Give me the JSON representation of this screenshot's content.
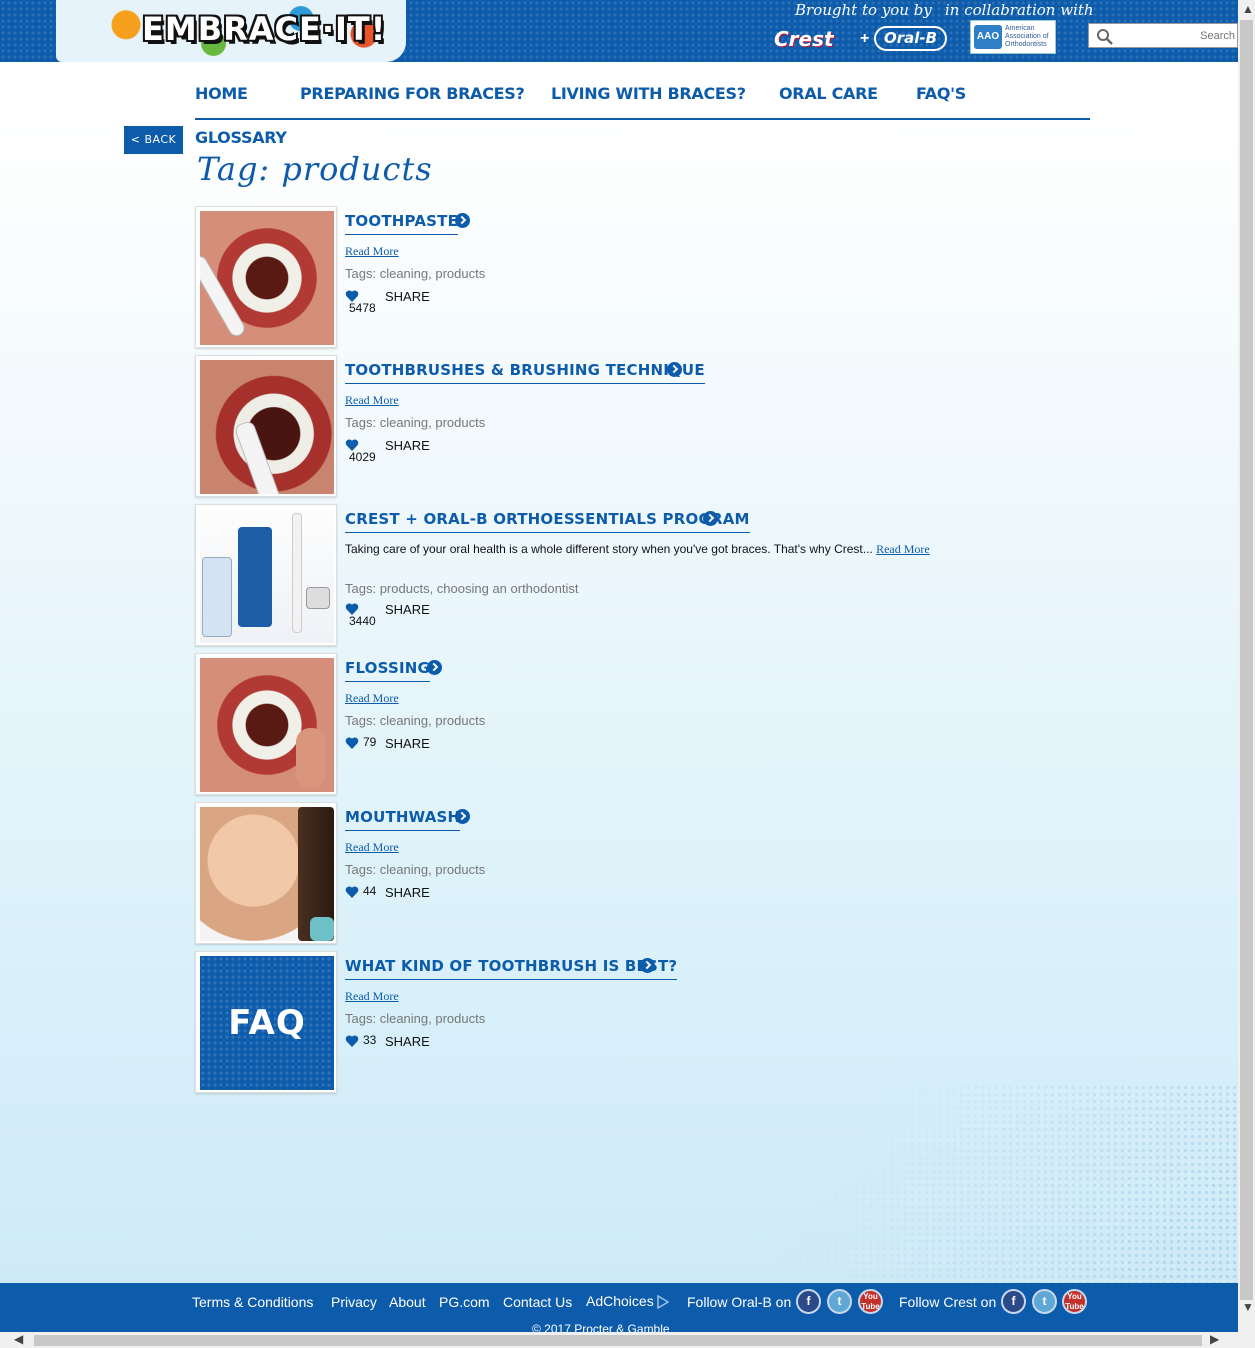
{
  "header": {
    "logo_text": "EMBRACE·IT!",
    "brought_by": "Brought to you by",
    "collab": "in collabration with",
    "crest": "Crest",
    "plus": "+",
    "oralb": "Oral-B",
    "aao_badge": "AAO",
    "aao_text": "American Association of Orthodontists",
    "search_placeholder": "Search"
  },
  "nav": {
    "items": [
      "HOME",
      "PREPARING FOR BRACES?",
      "LIVING WITH BRACES?",
      "ORAL CARE",
      "FAQ'S"
    ],
    "glossary": "GLOSSARY",
    "back": "< BACK"
  },
  "page_title": "Tag: products",
  "items": [
    {
      "title": "TOOTHPASTE",
      "read_more": "Read More",
      "tags_label": "Tags:",
      "tags": "cleaning, products",
      "likes": "5478",
      "share": "SHARE"
    },
    {
      "title": "TOOTHBRUSHES & BRUSHING TECHNIQUE",
      "read_more": "Read More",
      "tags_label": "Tags:",
      "tags": "cleaning, products",
      "likes": "4029",
      "share": "SHARE"
    },
    {
      "title": "CREST + ORAL-B ORTHOESSENTIALS PROGRAM",
      "excerpt": "Taking care of your oral health is a whole different story when you've got braces. That's why Crest...",
      "read_more": "Read More",
      "tags_label": "Tags:",
      "tags": "products, choosing an orthodontist",
      "likes": "3440",
      "share": "SHARE"
    },
    {
      "title": "FLOSSING",
      "read_more": "Read More",
      "tags_label": "Tags:",
      "tags": "cleaning, products",
      "likes": "79",
      "share": "SHARE"
    },
    {
      "title": "MOUTHWASH",
      "read_more": "Read More",
      "tags_label": "Tags:",
      "tags": "cleaning, products",
      "likes": "44",
      "share": "SHARE"
    },
    {
      "title": "WHAT KIND OF TOOTHBRUSH IS BEST?",
      "read_more": "Read More",
      "tags_label": "Tags:",
      "tags": "cleaning, products",
      "likes": "33",
      "share": "SHARE",
      "thumb_text": "FAQ"
    }
  ],
  "footer": {
    "links": [
      "Terms & Conditions",
      "Privacy",
      "About",
      "PG.com",
      "Contact Us",
      "AdChoices"
    ],
    "follow_oralb": "Follow Oral-B on",
    "follow_crest": "Follow Crest on",
    "fb": "f",
    "tw": "t",
    "yt": "You Tube",
    "copyright": "© 2017 Procter & Gamble"
  },
  "colors": {
    "brand_blue": "#0d5bab",
    "tag_gray": "#777777"
  },
  "icons": [
    "search-icon",
    "arrow-circle-icon",
    "heart-icon",
    "facebook-icon",
    "twitter-icon",
    "youtube-icon",
    "adchoices-icon"
  ]
}
